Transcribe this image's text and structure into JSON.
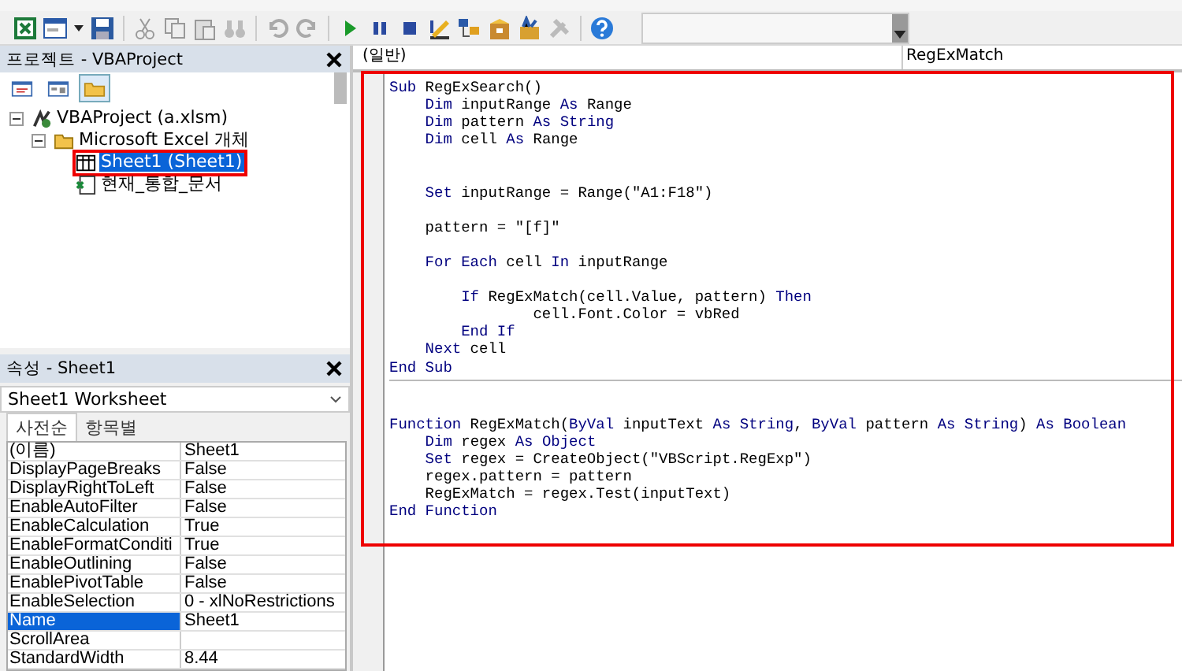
{
  "project_pane": {
    "title": "프로젝트 - VBAProject",
    "view_buttons": [
      {
        "kind": "view-code",
        "selected": false
      },
      {
        "kind": "view-object",
        "selected": false
      },
      {
        "kind": "toggle-folders",
        "selected": true
      }
    ],
    "tree": [
      {
        "label": "VBAProject (a.xlsm)",
        "kind": "project",
        "expanded": true,
        "selected": false,
        "highlighted": false,
        "children": [
          {
            "label": "Microsoft Excel 개체",
            "kind": "folder",
            "expanded": true,
            "selected": false,
            "highlighted": false,
            "children": [
              {
                "label": "Sheet1 (Sheet1)",
                "kind": "sheet",
                "selected": true,
                "highlighted": true
              },
              {
                "label": "현재_통합_문서",
                "kind": "workbook",
                "selected": false,
                "highlighted": false
              }
            ]
          }
        ]
      }
    ]
  },
  "properties_pane": {
    "title": "속성 - Sheet1",
    "object": "Sheet1 Worksheet",
    "tabs": [
      {
        "label": "사전순",
        "selected": true
      },
      {
        "label": "항목별",
        "selected": false
      }
    ],
    "rows": [
      {
        "name": "(이름)",
        "value": "Sheet1",
        "selected": false
      },
      {
        "name": "DisplayPageBreaks",
        "value": "False",
        "selected": false
      },
      {
        "name": "DisplayRightToLeft",
        "value": "False",
        "selected": false
      },
      {
        "name": "EnableAutoFilter",
        "value": "False",
        "selected": false
      },
      {
        "name": "EnableCalculation",
        "value": "True",
        "selected": false
      },
      {
        "name": "EnableFormatConditi",
        "value": "True",
        "selected": false
      },
      {
        "name": "EnableOutlining",
        "value": "False",
        "selected": false
      },
      {
        "name": "EnablePivotTable",
        "value": "False",
        "selected": false
      },
      {
        "name": "EnableSelection",
        "value": "0 - xlNoRestrictions",
        "selected": false
      },
      {
        "name": "Name",
        "value": "Sheet1",
        "selected": true
      },
      {
        "name": "ScrollArea",
        "value": "",
        "selected": false
      },
      {
        "name": "StandardWidth",
        "value": "8.44",
        "selected": false
      }
    ]
  },
  "code_window": {
    "object_combo": "(일반)",
    "procedure_combo": "RegExMatch",
    "highlighted": true,
    "procedures": [
      {
        "lines": [
          {
            "kind": "code",
            "tokens": [
              {
                "kind": "keyword",
                "text": "Sub"
              },
              {
                "kind": "plain",
                "text": " RegExSearch()"
              }
            ]
          },
          {
            "kind": "code",
            "tokens": [
              {
                "kind": "keyword",
                "text": "    Dim"
              },
              {
                "kind": "plain",
                "text": " inputRange "
              },
              {
                "kind": "keyword",
                "text": "As"
              },
              {
                "kind": "plain",
                "text": " Range"
              }
            ]
          },
          {
            "kind": "code",
            "tokens": [
              {
                "kind": "keyword",
                "text": "    Dim"
              },
              {
                "kind": "plain",
                "text": " pattern "
              },
              {
                "kind": "keyword",
                "text": "As String"
              }
            ]
          },
          {
            "kind": "code",
            "tokens": [
              {
                "kind": "keyword",
                "text": "    Dim"
              },
              {
                "kind": "plain",
                "text": " cell "
              },
              {
                "kind": "keyword",
                "text": "As"
              },
              {
                "kind": "plain",
                "text": " Range"
              }
            ]
          },
          {
            "kind": "blank"
          },
          {
            "kind": "blank"
          },
          {
            "kind": "code",
            "tokens": [
              {
                "kind": "keyword",
                "text": "    Set"
              },
              {
                "kind": "plain",
                "text": " inputRange = Range(\"A1:F18\")"
              }
            ]
          },
          {
            "kind": "blank"
          },
          {
            "kind": "code",
            "tokens": [
              {
                "kind": "plain",
                "text": "    pattern = \"[f]\""
              }
            ]
          },
          {
            "kind": "blank"
          },
          {
            "kind": "code",
            "tokens": [
              {
                "kind": "keyword",
                "text": "    For Each"
              },
              {
                "kind": "plain",
                "text": " cell "
              },
              {
                "kind": "keyword",
                "text": "In"
              },
              {
                "kind": "plain",
                "text": " inputRange"
              }
            ]
          },
          {
            "kind": "blank"
          },
          {
            "kind": "code",
            "tokens": [
              {
                "kind": "keyword",
                "text": "        If"
              },
              {
                "kind": "plain",
                "text": " RegExMatch(cell.Value, pattern) "
              },
              {
                "kind": "keyword",
                "text": "Then"
              }
            ]
          },
          {
            "kind": "code",
            "tokens": [
              {
                "kind": "plain",
                "text": "                cell.Font.Color = vbRed"
              }
            ]
          },
          {
            "kind": "code",
            "tokens": [
              {
                "kind": "keyword",
                "text": "        End If"
              }
            ]
          },
          {
            "kind": "code",
            "tokens": [
              {
                "kind": "keyword",
                "text": "    Next"
              },
              {
                "kind": "plain",
                "text": " cell"
              }
            ]
          },
          {
            "kind": "code",
            "tokens": [
              {
                "kind": "keyword",
                "text": "End Sub"
              }
            ]
          }
        ]
      },
      {
        "lines": [
          {
            "kind": "blank"
          },
          {
            "kind": "blank"
          },
          {
            "kind": "code",
            "tokens": [
              {
                "kind": "keyword",
                "text": "Function"
              },
              {
                "kind": "plain",
                "text": " RegExMatch("
              },
              {
                "kind": "keyword",
                "text": "ByVal"
              },
              {
                "kind": "plain",
                "text": " inputText "
              },
              {
                "kind": "keyword",
                "text": "As String"
              },
              {
                "kind": "plain",
                "text": ", "
              },
              {
                "kind": "keyword",
                "text": "ByVal"
              },
              {
                "kind": "plain",
                "text": " pattern "
              },
              {
                "kind": "keyword",
                "text": "As String"
              },
              {
                "kind": "plain",
                "text": ") "
              },
              {
                "kind": "keyword",
                "text": "As Boolean"
              }
            ]
          },
          {
            "kind": "code",
            "tokens": [
              {
                "kind": "keyword",
                "text": "    Dim"
              },
              {
                "kind": "plain",
                "text": " regex "
              },
              {
                "kind": "keyword",
                "text": "As Object"
              }
            ]
          },
          {
            "kind": "code",
            "tokens": [
              {
                "kind": "keyword",
                "text": "    Set"
              },
              {
                "kind": "plain",
                "text": " regex = CreateObject(\"VBScript.RegExp\")"
              }
            ]
          },
          {
            "kind": "code",
            "tokens": [
              {
                "kind": "plain",
                "text": "    regex.pattern = pattern"
              }
            ]
          },
          {
            "kind": "code",
            "tokens": [
              {
                "kind": "plain",
                "text": "    RegExMatch = regex.Test(inputText)"
              }
            ]
          },
          {
            "kind": "code",
            "tokens": [
              {
                "kind": "keyword",
                "text": "End Function"
              }
            ]
          }
        ]
      }
    ]
  }
}
